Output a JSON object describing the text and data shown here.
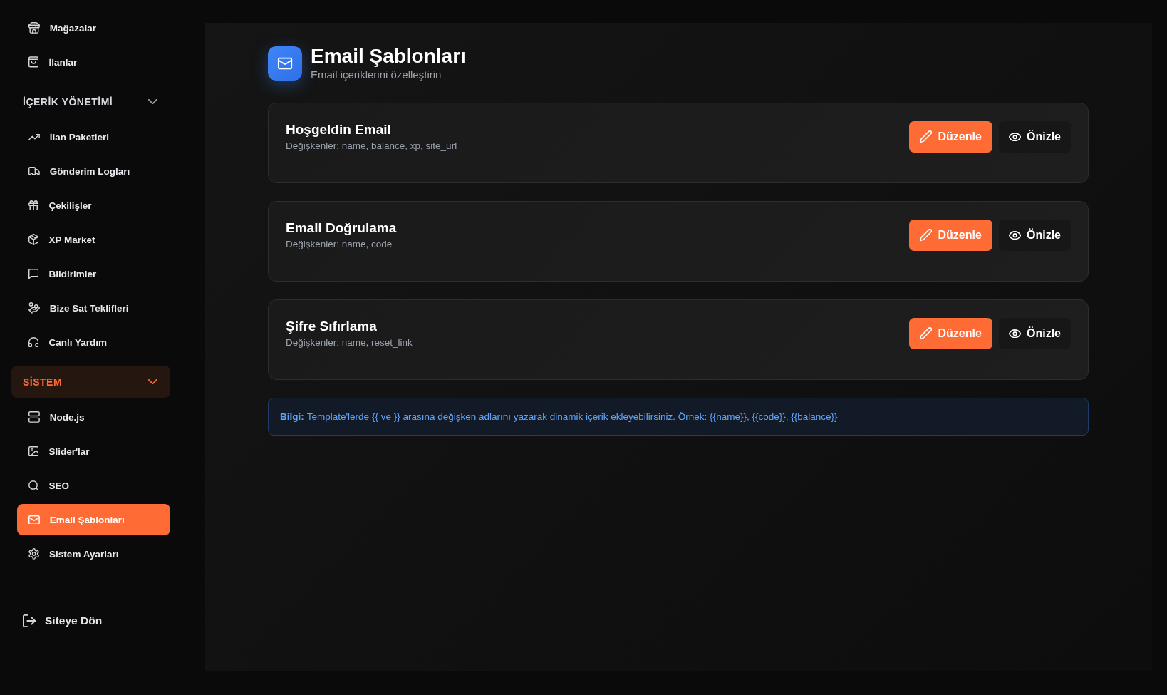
{
  "sidebar": {
    "items": [
      {
        "label": "Mağazalar",
        "selected": false
      },
      {
        "label": "İlanlar",
        "selected": false
      }
    ],
    "sections": [
      {
        "title": "İÇERİK YÖNETİMİ",
        "expanded": true,
        "active": false,
        "items": [
          {
            "label": "İlan Paketleri",
            "selected": false
          },
          {
            "label": "Gönderim Logları",
            "selected": false
          },
          {
            "label": "Çekilişler",
            "selected": false
          },
          {
            "label": "XP Market",
            "selected": false
          },
          {
            "label": "Bildirimler",
            "selected": false
          },
          {
            "label": "Bize Sat Teklifleri",
            "selected": false
          },
          {
            "label": "Canlı Yardım",
            "selected": false
          }
        ]
      },
      {
        "title": "SİSTEM",
        "expanded": true,
        "active": true,
        "items": [
          {
            "label": "Node.js",
            "selected": false
          },
          {
            "label": "Slider'lar",
            "selected": false
          },
          {
            "label": "SEO",
            "selected": false
          },
          {
            "label": "Email Şablonları",
            "selected": true
          },
          {
            "label": "Sistem Ayarları",
            "selected": false
          }
        ]
      }
    ],
    "back_link": "Siteye Dön"
  },
  "header": {
    "title": "Email Şablonları",
    "subtitle": "Email içeriklerini özelleştirin"
  },
  "templates": [
    {
      "name": "Hoşgeldin Email",
      "variables": "Değişkenler: name, balance, xp, site_url",
      "edit_label": "Düzenle",
      "preview_label": "Önizle"
    },
    {
      "name": "Email Doğrulama",
      "variables": "Değişkenler: name, code",
      "edit_label": "Düzenle",
      "preview_label": "Önizle"
    },
    {
      "name": "Şifre Sıfırlama",
      "variables": "Değişkenler: name, reset_link",
      "edit_label": "Düzenle",
      "preview_label": "Önizle"
    }
  ],
  "info": "**Bilgi:** Template'lerde {{ ve }} arasına değişken adlarını yazarak dinamik içerik ekleyebilirsiniz. Örnek: {{name}}, {{code}}, {{balance}}"
}
